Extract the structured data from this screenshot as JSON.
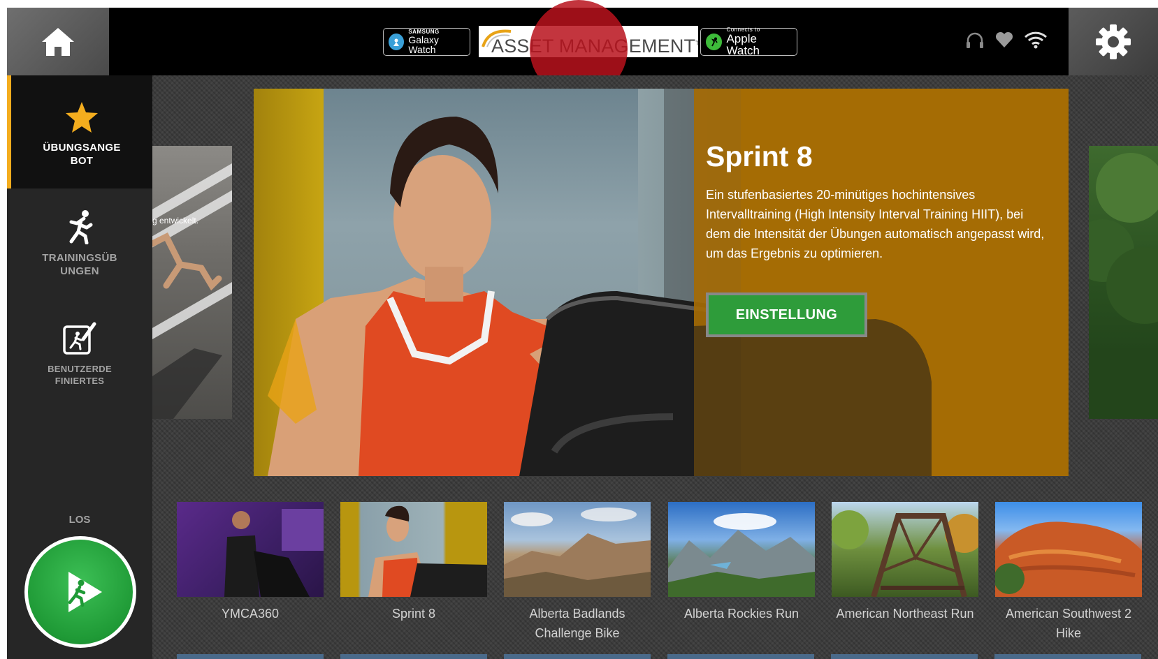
{
  "topbar": {
    "home_icon": "home-icon",
    "settings_icon": "gear-icon",
    "samsung_badge": {
      "small": "SAMSUNG",
      "big": "Galaxy Watch"
    },
    "asset_logo": {
      "text": "ASSET MANAGEMENT",
      "tm": "TM"
    },
    "apple_badge": {
      "small": "Connects to",
      "big": "Apple Watch"
    },
    "status_icons": [
      "headphones-icon",
      "heart-icon",
      "wifi-icon"
    ]
  },
  "sidebar": {
    "items": [
      {
        "label": "ÜBUNGSANGE\nBOT",
        "icon": "star-icon",
        "active": true
      },
      {
        "label": "TRAININGSÜB\nUNGEN",
        "icon": "runner-icon",
        "active": false
      },
      {
        "label": "BENUTZERDE\nFINIERTES",
        "icon": "custom-workout-icon",
        "active": false
      }
    ],
    "go_label": "LOS",
    "go_icon": "play-runner-icon"
  },
  "featured": {
    "title": "Sprint 8",
    "description": "Ein stufenbasiertes 20-minütiges hochintensives Intervalltraining (High Intensity Interval Training HIIT), bei dem die Intensität der Übungen automatisch angepasst wird, um das Ergebnis zu optimieren.",
    "button_label": "EINSTELLUNG",
    "left_peek_caption": "g entwickelt."
  },
  "workouts": [
    {
      "title": "YMCA360"
    },
    {
      "title": "Sprint 8"
    },
    {
      "title": "Alberta Badlands Challenge Bike"
    },
    {
      "title": "Alberta Rockies Run"
    },
    {
      "title": "American Northeast Run"
    },
    {
      "title": "American Southwest 2 Hike"
    }
  ],
  "colors": {
    "accent": "#f4ad1e",
    "go_green": "#2e9c3a",
    "hero_overlay": "#a46a04"
  }
}
